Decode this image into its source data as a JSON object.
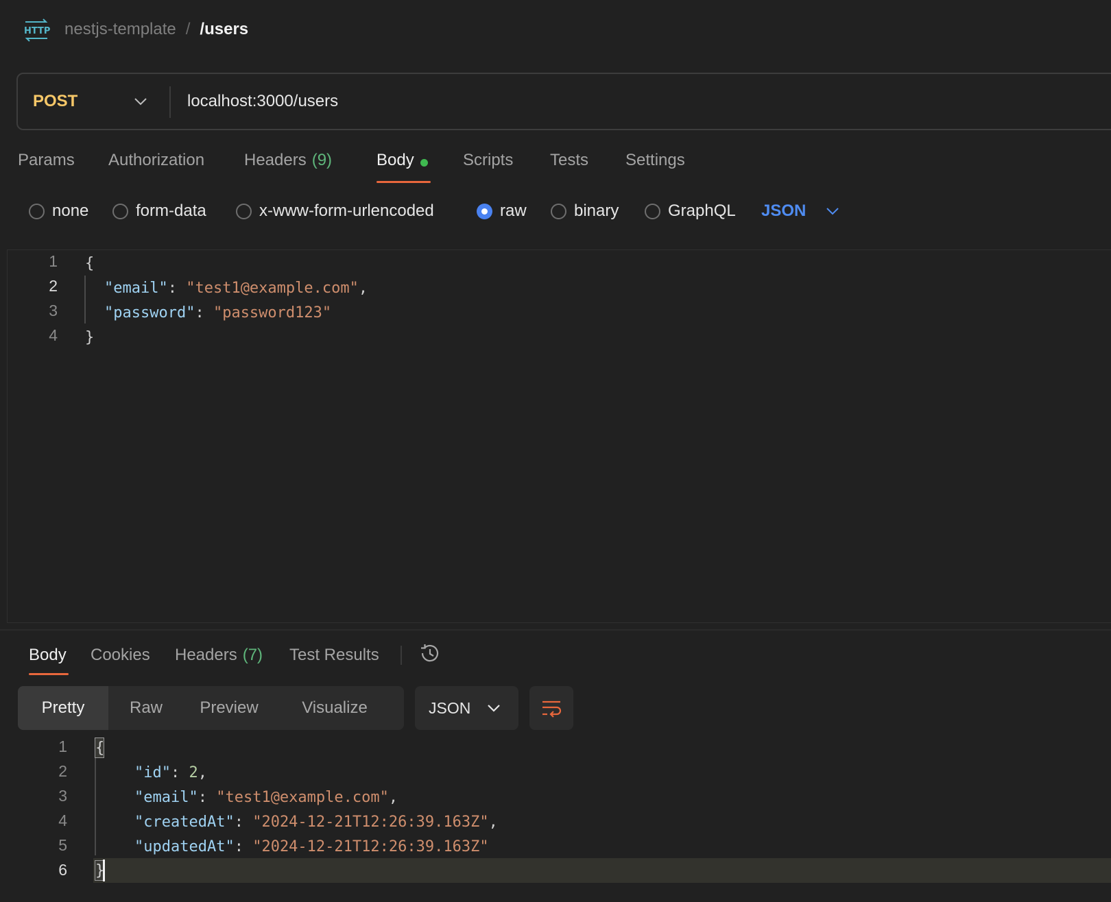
{
  "header": {
    "icon": "http-icon",
    "collection": "nestjs-template",
    "separator": "/",
    "request_name": "/users"
  },
  "request": {
    "method": "POST",
    "url": "localhost:3000/users"
  },
  "request_tabs": [
    {
      "label": "Params"
    },
    {
      "label": "Authorization"
    },
    {
      "label": "Headers",
      "count": "(9)"
    },
    {
      "label": "Body",
      "active": true,
      "has_indicator": true
    },
    {
      "label": "Scripts"
    },
    {
      "label": "Tests"
    },
    {
      "label": "Settings"
    }
  ],
  "body_types": [
    {
      "label": "none",
      "checked": false
    },
    {
      "label": "form-data",
      "checked": false
    },
    {
      "label": "x-www-form-urlencoded",
      "checked": false
    },
    {
      "label": "raw",
      "checked": true
    },
    {
      "label": "binary",
      "checked": false
    },
    {
      "label": "GraphQL",
      "checked": false
    }
  ],
  "raw_language": "JSON",
  "request_body": {
    "line_numbers": [
      "1",
      "2",
      "3",
      "4"
    ],
    "open_brace": "{",
    "close_brace": "}",
    "fields": [
      {
        "key": "\"email\"",
        "colon": ": ",
        "value": "\"test1@example.com\"",
        "comma": ","
      },
      {
        "key": "\"password\"",
        "colon": ": ",
        "value": "\"password123\"",
        "comma": ""
      }
    ]
  },
  "response_tabs": [
    {
      "label": "Body",
      "active": true
    },
    {
      "label": "Cookies"
    },
    {
      "label": "Headers",
      "count": "(7)"
    },
    {
      "label": "Test Results"
    }
  ],
  "view_modes": [
    {
      "label": "Pretty",
      "active": true
    },
    {
      "label": "Raw"
    },
    {
      "label": "Preview"
    },
    {
      "label": "Visualize"
    }
  ],
  "response_format": "JSON",
  "response_body": {
    "line_numbers": [
      "1",
      "2",
      "3",
      "4",
      "5",
      "6"
    ],
    "open_brace": "{",
    "close_brace": "}",
    "fields": [
      {
        "key": "\"id\"",
        "colon": ": ",
        "value": "2",
        "comma": ",",
        "kind": "number"
      },
      {
        "key": "\"email\"",
        "colon": ": ",
        "value": "\"test1@example.com\"",
        "comma": ",",
        "kind": "string"
      },
      {
        "key": "\"createdAt\"",
        "colon": ": ",
        "value": "\"2024-12-21T12:26:39.163Z\"",
        "comma": ",",
        "kind": "string"
      },
      {
        "key": "\"updatedAt\"",
        "colon": ": ",
        "value": "\"2024-12-21T12:26:39.163Z\"",
        "comma": "",
        "kind": "string"
      }
    ]
  },
  "colors": {
    "background": "#212121",
    "method_post": "#f6c768",
    "accent_underline": "#e8673c",
    "count_green": "#5fb67b",
    "link_blue": "#4f8cf1",
    "json_key": "#9fd2f2",
    "json_string": "#cf8e6d"
  }
}
